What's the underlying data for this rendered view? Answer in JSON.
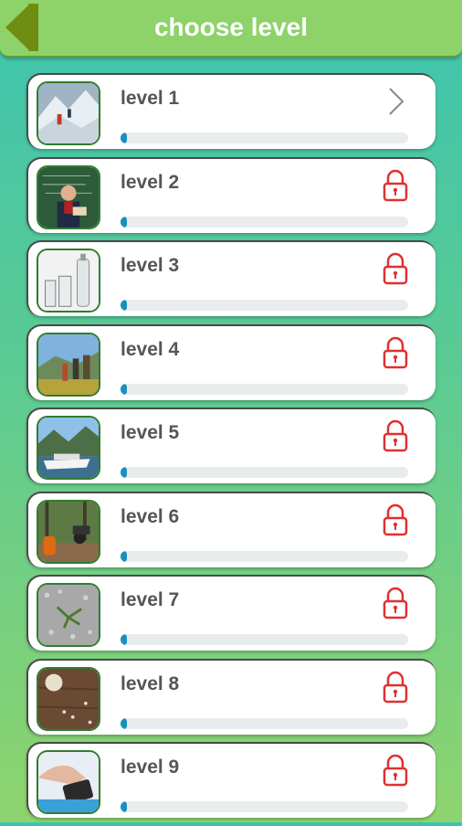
{
  "header": {
    "title": "choose level",
    "back_icon": "back-arrow-icon"
  },
  "colors": {
    "lock": "#e03030",
    "progress": "#1a8fbf",
    "track": "#e9ecec",
    "thumb_border": "#2f7d2e"
  },
  "levels": [
    {
      "label": "level 1",
      "status_icon": "chevron-right-icon",
      "locked": false,
      "progress": 0.02,
      "image": "mountain-climbers"
    },
    {
      "label": "level 2",
      "status_icon": "lock-icon",
      "locked": true,
      "progress": 0.02,
      "image": "boy-at-chalkboard"
    },
    {
      "label": "level 3",
      "status_icon": "lock-icon",
      "locked": true,
      "progress": 0.02,
      "image": "glass-bottles"
    },
    {
      "label": "level 4",
      "status_icon": "lock-icon",
      "locked": true,
      "progress": 0.02,
      "image": "hikers"
    },
    {
      "label": "level 5",
      "status_icon": "lock-icon",
      "locked": true,
      "progress": 0.02,
      "image": "ship-in-fjord"
    },
    {
      "label": "level 6",
      "status_icon": "lock-icon",
      "locked": true,
      "progress": 0.02,
      "image": "forest-atv"
    },
    {
      "label": "level 7",
      "status_icon": "lock-icon",
      "locked": true,
      "progress": 0.02,
      "image": "plant-on-gravel"
    },
    {
      "label": "level 8",
      "status_icon": "lock-icon",
      "locked": true,
      "progress": 0.02,
      "image": "wood-with-coins"
    },
    {
      "label": "level 9",
      "status_icon": "lock-icon",
      "locked": true,
      "progress": 0.02,
      "image": "hand-with-object"
    }
  ]
}
